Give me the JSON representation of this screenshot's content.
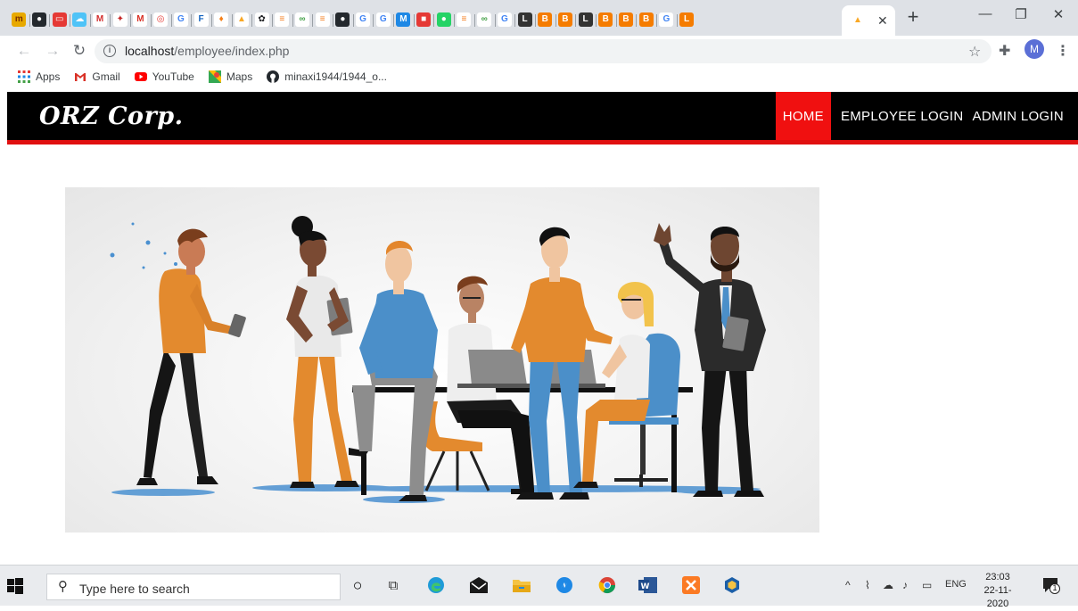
{
  "browser": {
    "pinned_tabs": [
      {
        "icon": "my-logo-icon",
        "glyph": "m",
        "bg": "#e8a900",
        "fg": "#7a2d00"
      },
      {
        "icon": "github-icon",
        "glyph": "●",
        "bg": "#24292e",
        "fg": "#ffffff"
      },
      {
        "icon": "red-square-icon",
        "glyph": "▭",
        "bg": "#e53935",
        "fg": "#ffffff"
      },
      {
        "icon": "cloud-icon",
        "glyph": "☁",
        "bg": "#4fc3f7",
        "fg": "#ffffff"
      },
      {
        "icon": "m-red-icon",
        "glyph": "M",
        "bg": "#ffffff",
        "fg": "#d32f2f"
      },
      {
        "icon": "bird-icon",
        "glyph": "✦",
        "bg": "#ffffff",
        "fg": "#c62828"
      },
      {
        "icon": "gmail-icon",
        "glyph": "M",
        "bg": "#ffffff",
        "fg": "#d93025"
      },
      {
        "icon": "target-icon",
        "glyph": "◎",
        "bg": "#ffffff",
        "fg": "#e53935"
      },
      {
        "icon": "google-icon",
        "glyph": "G",
        "bg": "#ffffff",
        "fg": "#4285f4"
      },
      {
        "icon": "f-icon",
        "glyph": "F",
        "bg": "#ffffff",
        "fg": "#1565c0"
      },
      {
        "icon": "plug-icon",
        "glyph": "♦",
        "bg": "#ffffff",
        "fg": "#f57f17"
      },
      {
        "icon": "pma-icon",
        "glyph": "▲",
        "bg": "#ffffff",
        "fg": "#f9a825"
      },
      {
        "icon": "openai-icon",
        "glyph": "✿",
        "bg": "#ffffff",
        "fg": "#202124"
      },
      {
        "icon": "stack-icon",
        "glyph": "≡",
        "bg": "#ffffff",
        "fg": "#f48024"
      },
      {
        "icon": "infinity-icon",
        "glyph": "∞",
        "bg": "#ffffff",
        "fg": "#43a047"
      },
      {
        "icon": "stack-icon",
        "glyph": "≡",
        "bg": "#ffffff",
        "fg": "#f48024"
      },
      {
        "icon": "github-icon",
        "glyph": "●",
        "bg": "#24292e",
        "fg": "#ffffff"
      },
      {
        "icon": "google-icon",
        "glyph": "G",
        "bg": "#ffffff",
        "fg": "#4285f4"
      },
      {
        "icon": "google-icon",
        "glyph": "G",
        "bg": "#ffffff",
        "fg": "#4285f4"
      },
      {
        "icon": "mail-icon",
        "glyph": "M",
        "bg": "#1e88e5",
        "fg": "#ffffff"
      },
      {
        "icon": "red-app-icon",
        "glyph": "■",
        "bg": "#e53935",
        "fg": "#ffffff"
      },
      {
        "icon": "whatsapp-icon",
        "glyph": "●",
        "bg": "#25d366",
        "fg": "#ffffff"
      },
      {
        "icon": "stack-icon",
        "glyph": "≡",
        "bg": "#ffffff",
        "fg": "#f48024"
      },
      {
        "icon": "infinity-icon",
        "glyph": "∞",
        "bg": "#ffffff",
        "fg": "#43a047"
      },
      {
        "icon": "google-icon",
        "glyph": "G",
        "bg": "#ffffff",
        "fg": "#4285f4"
      },
      {
        "icon": "leetcode-icon",
        "glyph": "L",
        "bg": "#333333",
        "fg": "#ffffff"
      },
      {
        "icon": "orange-app-icon",
        "glyph": "B",
        "bg": "#f57c00",
        "fg": "#ffffff"
      },
      {
        "icon": "orange-app-icon",
        "glyph": "B",
        "bg": "#f57c00",
        "fg": "#ffffff"
      },
      {
        "icon": "leetcode-icon",
        "glyph": "L",
        "bg": "#333333",
        "fg": "#ffffff"
      },
      {
        "icon": "orange-app-icon",
        "glyph": "B",
        "bg": "#f57c00",
        "fg": "#ffffff"
      },
      {
        "icon": "orange-app-icon",
        "glyph": "B",
        "bg": "#f57c00",
        "fg": "#ffffff"
      },
      {
        "icon": "orange-app-icon",
        "glyph": "B",
        "bg": "#f57c00",
        "fg": "#ffffff"
      },
      {
        "icon": "google-icon",
        "glyph": "G",
        "bg": "#ffffff",
        "fg": "#4285f4"
      },
      {
        "icon": "leetcode-orange-icon",
        "glyph": "L",
        "bg": "#f57c00",
        "fg": "#ffffff"
      }
    ],
    "active_tab_icon": "pma-icon",
    "address_host": "localhost",
    "address_path": "/employee/index.php",
    "bookmarks": [
      {
        "label": "Apps",
        "icon": "apps-grid-icon"
      },
      {
        "label": "Gmail",
        "icon": "gmail-icon"
      },
      {
        "label": "YouTube",
        "icon": "youtube-icon"
      },
      {
        "label": "Maps",
        "icon": "maps-icon"
      },
      {
        "label": "minaxi1944/1944_o...",
        "icon": "github-icon"
      }
    ],
    "profile_initial": "M"
  },
  "site": {
    "brand": "ORZ Corp.",
    "nav": [
      {
        "label": "HOME",
        "active": true
      },
      {
        "label": "EMPLOYEE LOGIN",
        "active": false
      },
      {
        "label": "ADMIN LOGIN",
        "active": false
      }
    ],
    "accent_color": "#f01010"
  },
  "taskbar": {
    "search_placeholder": "Type here to search",
    "tray_language": "ENG",
    "time": "23:03",
    "date": "22-11-2020",
    "notification_count": "1"
  }
}
